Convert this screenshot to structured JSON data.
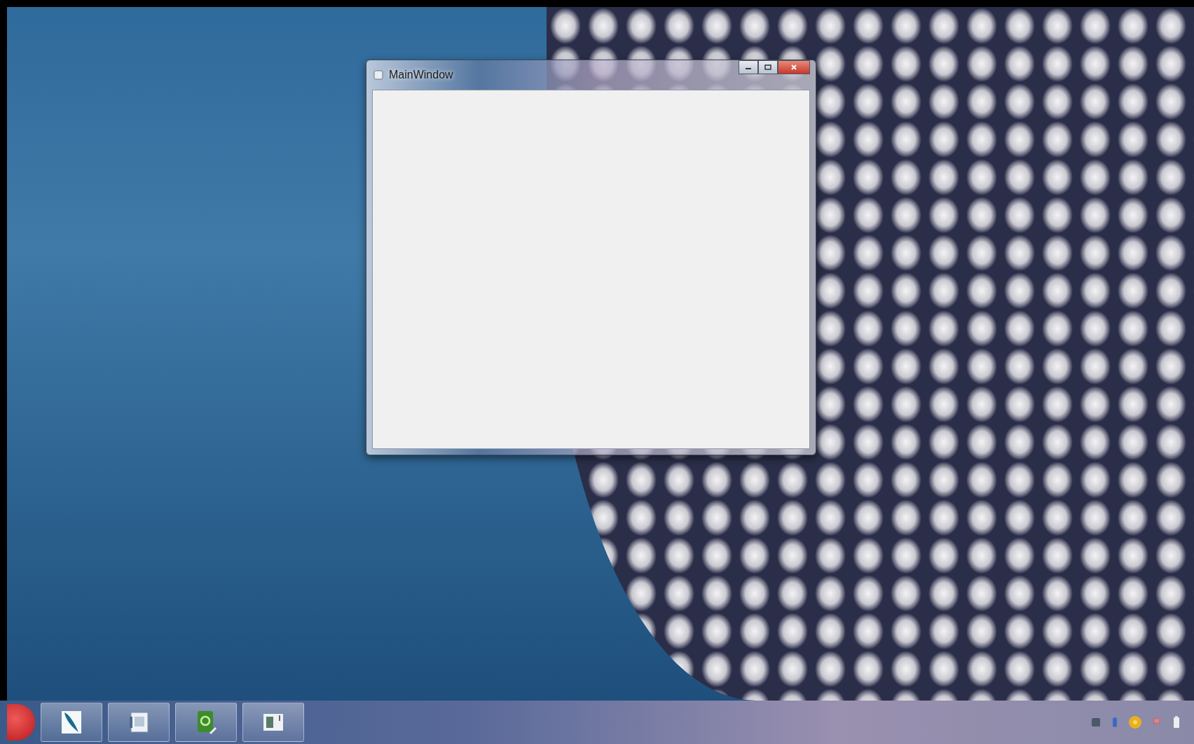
{
  "window": {
    "title": "MainWindow"
  }
}
